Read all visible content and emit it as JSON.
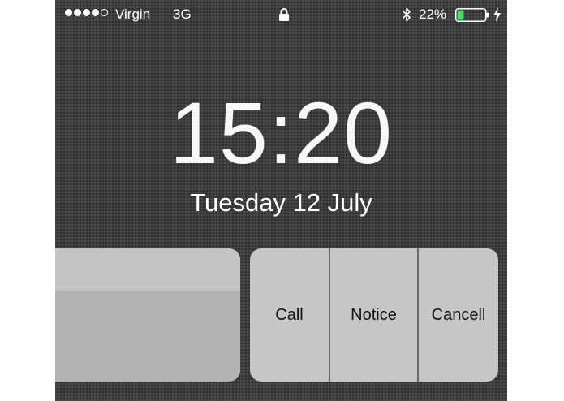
{
  "status_bar": {
    "signal_bars_filled": 4,
    "signal_bars_total": 5,
    "carrier": "Virgin",
    "network": "3G",
    "lock_icon": "lock-icon",
    "bluetooth_icon": "bluetooth-icon",
    "battery_percent": "22%",
    "battery_level": 0.22,
    "battery_color": "#4cd964",
    "charging_icon": "lightning-icon"
  },
  "lock_screen": {
    "time": "15:20",
    "date": "Tuesday 12 July"
  },
  "notification": {
    "actions": [
      {
        "label": "Call"
      },
      {
        "label": "Notice"
      },
      {
        "label": "Cancell"
      }
    ]
  }
}
